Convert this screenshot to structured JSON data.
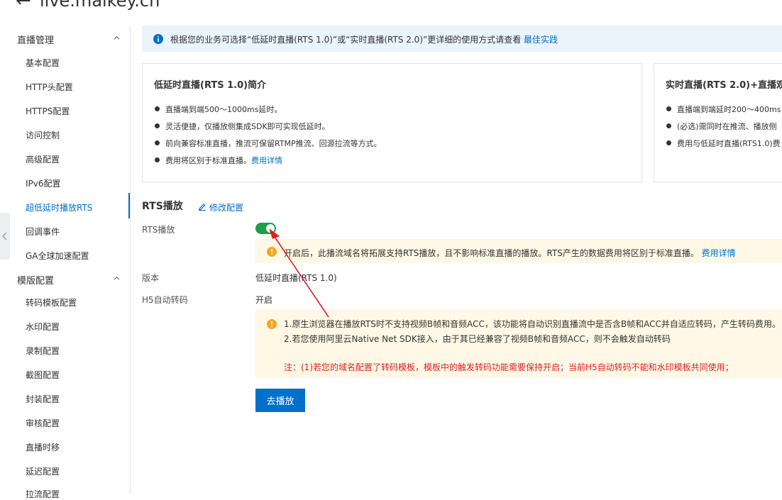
{
  "header": {
    "back_glyph": "←",
    "title": "live.maikey.cn"
  },
  "sidebar": {
    "groups": [
      {
        "label": "直播管理",
        "items": [
          "基本配置",
          "HTTP头配置",
          "HTTPS配置",
          "访问控制",
          "高级配置",
          "IPv6配置",
          "超低延时播放RTS",
          "回调事件",
          "GA全球加速配置"
        ]
      },
      {
        "label": "模版配置",
        "items": [
          "转码模板配置",
          "水印配置",
          "录制配置",
          "截图配置",
          "封装配置",
          "审核配置",
          "直播时移",
          "延迟配置",
          "拉流配置"
        ]
      }
    ],
    "active_item": "超低延时播放RTS"
  },
  "notice": {
    "text": "根据您的业务可选择“低延时直播(RTS 1.0)”或“实时直播(RTS 2.0)”更详细的使用方式请查看",
    "link": "最佳实践"
  },
  "cards": [
    {
      "title": "低延时直播(RTS 1.0)简介",
      "bullets": [
        "直播端到端500～1000ms延时。",
        "灵活便捷，仅播放侧集成SDK即可实现低延时。",
        "前向兼容标准直播，推流可保留RTMP推流、回源拉流等方式。",
        "费用将区别于标准直播。"
      ],
      "link": "费用详情"
    },
    {
      "title": "实时直播(RTS 2.0)+直播观",
      "bullets": [
        "直播端到端延时200～400ms",
        "(必选)需同时在推流、播放侧",
        "费用与低延时直播(RTS1.0)费"
      ]
    }
  ],
  "rts": {
    "section_title": "RTS播放",
    "edit_label": "修改配置",
    "play_label": "RTS播放",
    "toggle_on": true,
    "play_warning": "开启后，此播流域名将拓展支持RTS播放，且不影响标准直播的播放。RTS产生的数据费用将区别于标准直播。",
    "play_warning_link": "费用详情",
    "version_label": "版本",
    "version_value": "低延时直播(RTS 1.0)",
    "h5_label": "H5自动转码",
    "h5_value": "开启",
    "h5_notes": [
      "1.原生浏览器在播放RTS时不支持视频B帧和音频ACC，该功能将自动识别直播流中是否含B帧和ACC并自适应转码，产生转码费用。",
      "2.若您使用阿里云Native Net SDK接入，由于其已经兼容了视频B帧和音频ACC，则不会触发自动转码"
    ],
    "h5_notes_link": "费",
    "h5_red_note": "注：(1)若您的域名配置了转码模板，模板中的触发转码功能需要保持开启；当前H5自动转码不能和水印模板共同使用；",
    "go_play_button": "去播放"
  },
  "colors": {
    "accent": "#0070cc",
    "toggle_on": "#1e9e47",
    "annotation_arrow": "#e02020",
    "warning": "#f5a623"
  }
}
